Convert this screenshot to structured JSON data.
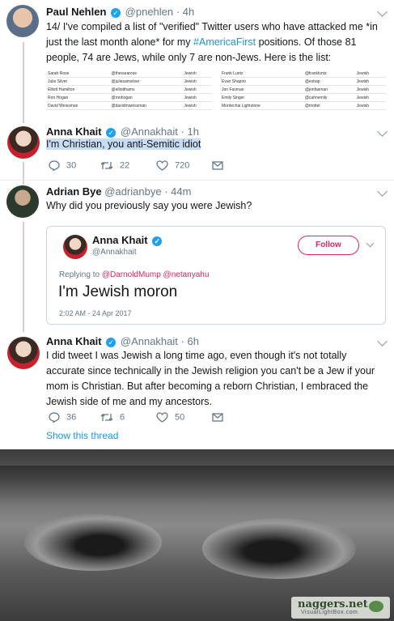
{
  "tweets": [
    {
      "name": "Paul Nehlen",
      "handle": "@pnehlen",
      "time": "4h",
      "text_parts": [
        "14/ I've compiled a list of \"verified\" Twitter users who have attacked me *in just the last month alone* for my ",
        "#AmericaFirst",
        " positions. Of those 81 people, 74 are Jews, while only 7 are non-Jews. Here is the list:"
      ],
      "list_left": [
        [
          "Sarah Rose",
          "@thesararose",
          "Jewish"
        ],
        [
          "Julie Silver",
          "@juliesamsilver",
          "Jewish"
        ],
        [
          "Elliott Hamilton",
          "@elliotthams",
          "Jewish"
        ],
        [
          "Ron Hogan",
          "@ronhogan",
          "Jewish"
        ],
        [
          "David Weissman",
          "@davidmweissman",
          "Jewish"
        ]
      ],
      "list_right": [
        [
          "Frank Luntz",
          "@frankluntz",
          "Jewish"
        ],
        [
          "Evan Shapiro",
          "@eshap",
          "Jewish"
        ],
        [
          "Jon Fasman",
          "@jonfasman",
          "Jewish"
        ],
        [
          "Emily Singer",
          "@cahnemily",
          "Jewish"
        ],
        [
          "Mordechai Lightstone",
          "@mottel",
          "Jewish"
        ]
      ]
    },
    {
      "name": "Anna Khait",
      "handle": "@Annakhait",
      "time": "1h",
      "text": "I'm Christian, you anti-Semitic idiot",
      "replies": "30",
      "retweets": "22",
      "likes": "720"
    },
    {
      "name": "Adrian Bye",
      "handle": "@adrianbye",
      "time": "44m",
      "text": "Why did you previously say you were Jewish?"
    },
    {
      "name": "Anna Khait",
      "handle": "@Annakhait",
      "time": "6h",
      "text": "I did tweet I was Jewish a long time ago, even though it's not totally accurate since technically in the Jewish religion you can't be a Jew if your mom is Christian. But after becoming a reborn Christian, I embraced the Jewish side of me and my ancestors.",
      "replies": "36",
      "retweets": "6",
      "likes": "50",
      "show_thread": "Show this thread"
    }
  ],
  "quoted": {
    "name": "Anna Khait",
    "handle": "@Annakhait",
    "follow_label": "Follow",
    "replying_prefix": "Replying to ",
    "replying_to": "@DarnoldMump @netanyahu",
    "text": "I'm Jewish moron",
    "timestamp": "2:02 AM - 24 Apr 2017"
  },
  "watermark": {
    "line1": "naggers.net",
    "line2": "VisualLightBox.com"
  },
  "colors": {
    "accent": "#1da1f2",
    "hashtag": "#1b95e0",
    "follow": "#e0245e",
    "highlight": "#c8dcf4"
  }
}
